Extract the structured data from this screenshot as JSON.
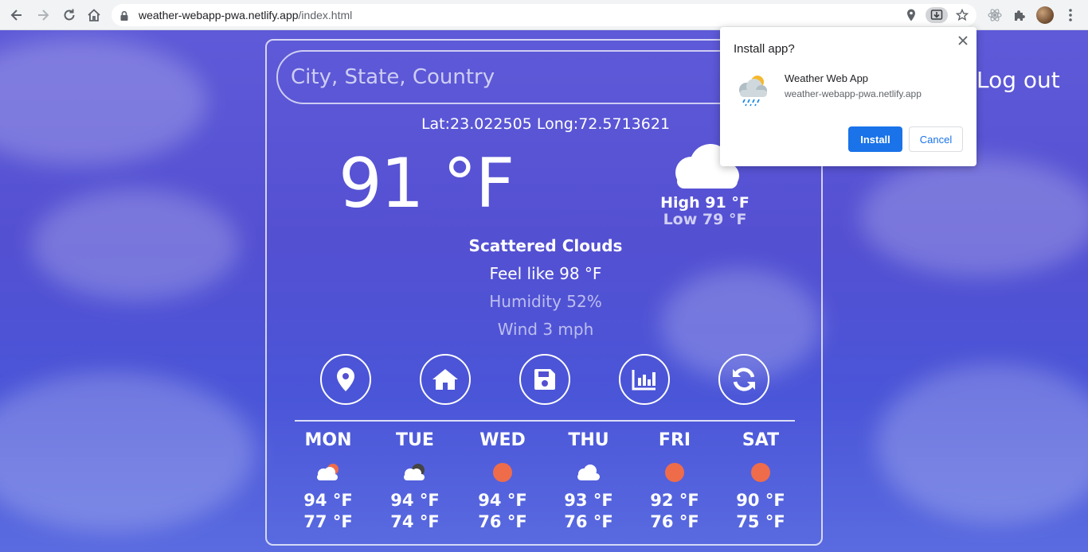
{
  "browser": {
    "url_host": "weather-webapp-pwa.netlify.app",
    "url_path": "/index.html",
    "icons": [
      "back-arrow-icon",
      "forward-arrow-icon",
      "reload-icon",
      "home-icon",
      "lock-icon",
      "location-icon",
      "install-app-icon",
      "bookmark-star-icon",
      "extension-icon",
      "puzzle-icon",
      "profile-avatar",
      "menu-dots-icon"
    ]
  },
  "search": {
    "placeholder": "City, State, Country"
  },
  "current": {
    "coords": "Lat:23.022505 Long:72.5713621",
    "temp": "91 °F",
    "high": "High 91 °F",
    "low": "Low 79 °F",
    "description": "Scattered Clouds",
    "feels_like": "Feel like 98 °F",
    "humidity": "Humidity 52%",
    "wind": "Wind 3 mph",
    "icon": "cloud-icon"
  },
  "actions": [
    "location-icon",
    "home-icon",
    "save-icon",
    "chart-icon",
    "refresh-icon"
  ],
  "forecast": [
    {
      "day": "MON",
      "high": "94 °F",
      "low": "77 °F",
      "icon": "partly-cloudy-icon"
    },
    {
      "day": "TUE",
      "high": "94 °F",
      "low": "74 °F",
      "icon": "cloudy-icon"
    },
    {
      "day": "WED",
      "high": "94 °F",
      "low": "76 °F",
      "icon": "sun-icon"
    },
    {
      "day": "THU",
      "high": "93 °F",
      "low": "76 °F",
      "icon": "cloud-icon"
    },
    {
      "day": "FRI",
      "high": "92 °F",
      "low": "76 °F",
      "icon": "sun-icon"
    },
    {
      "day": "SAT",
      "high": "90 °F",
      "low": "75 °F",
      "icon": "sun-icon"
    }
  ],
  "header": {
    "logout": "Log out"
  },
  "install_popup": {
    "title": "Install app?",
    "app_name": "Weather Web App",
    "app_url": "weather-webapp-pwa.netlify.app",
    "install_label": "Install",
    "cancel_label": "Cancel"
  },
  "colors": {
    "accent": "#1a73e8",
    "sun": "#ef6c4a",
    "background": "#5b57d6"
  }
}
